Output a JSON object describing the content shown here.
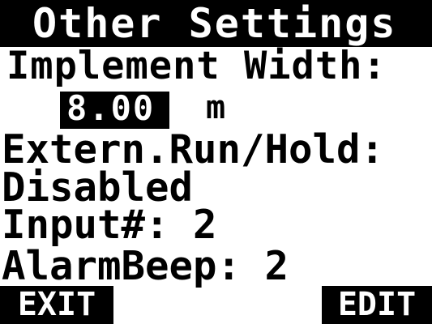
{
  "screen": {
    "title": "Other Settings",
    "implement_width": {
      "label": "Implement Width:",
      "value": "8.00",
      "unit": "m"
    },
    "extern_run_hold": {
      "label": "Extern.Run/Hold:",
      "value": "Disabled"
    },
    "input_number": "Input#: 2",
    "alarm_beep": "AlarmBeep: 2"
  },
  "softkeys": {
    "left": "EXIT",
    "right": "EDIT"
  },
  "colors": {
    "background": "#ffffff",
    "foreground": "#000000",
    "inverse_text": "#ffffff"
  }
}
